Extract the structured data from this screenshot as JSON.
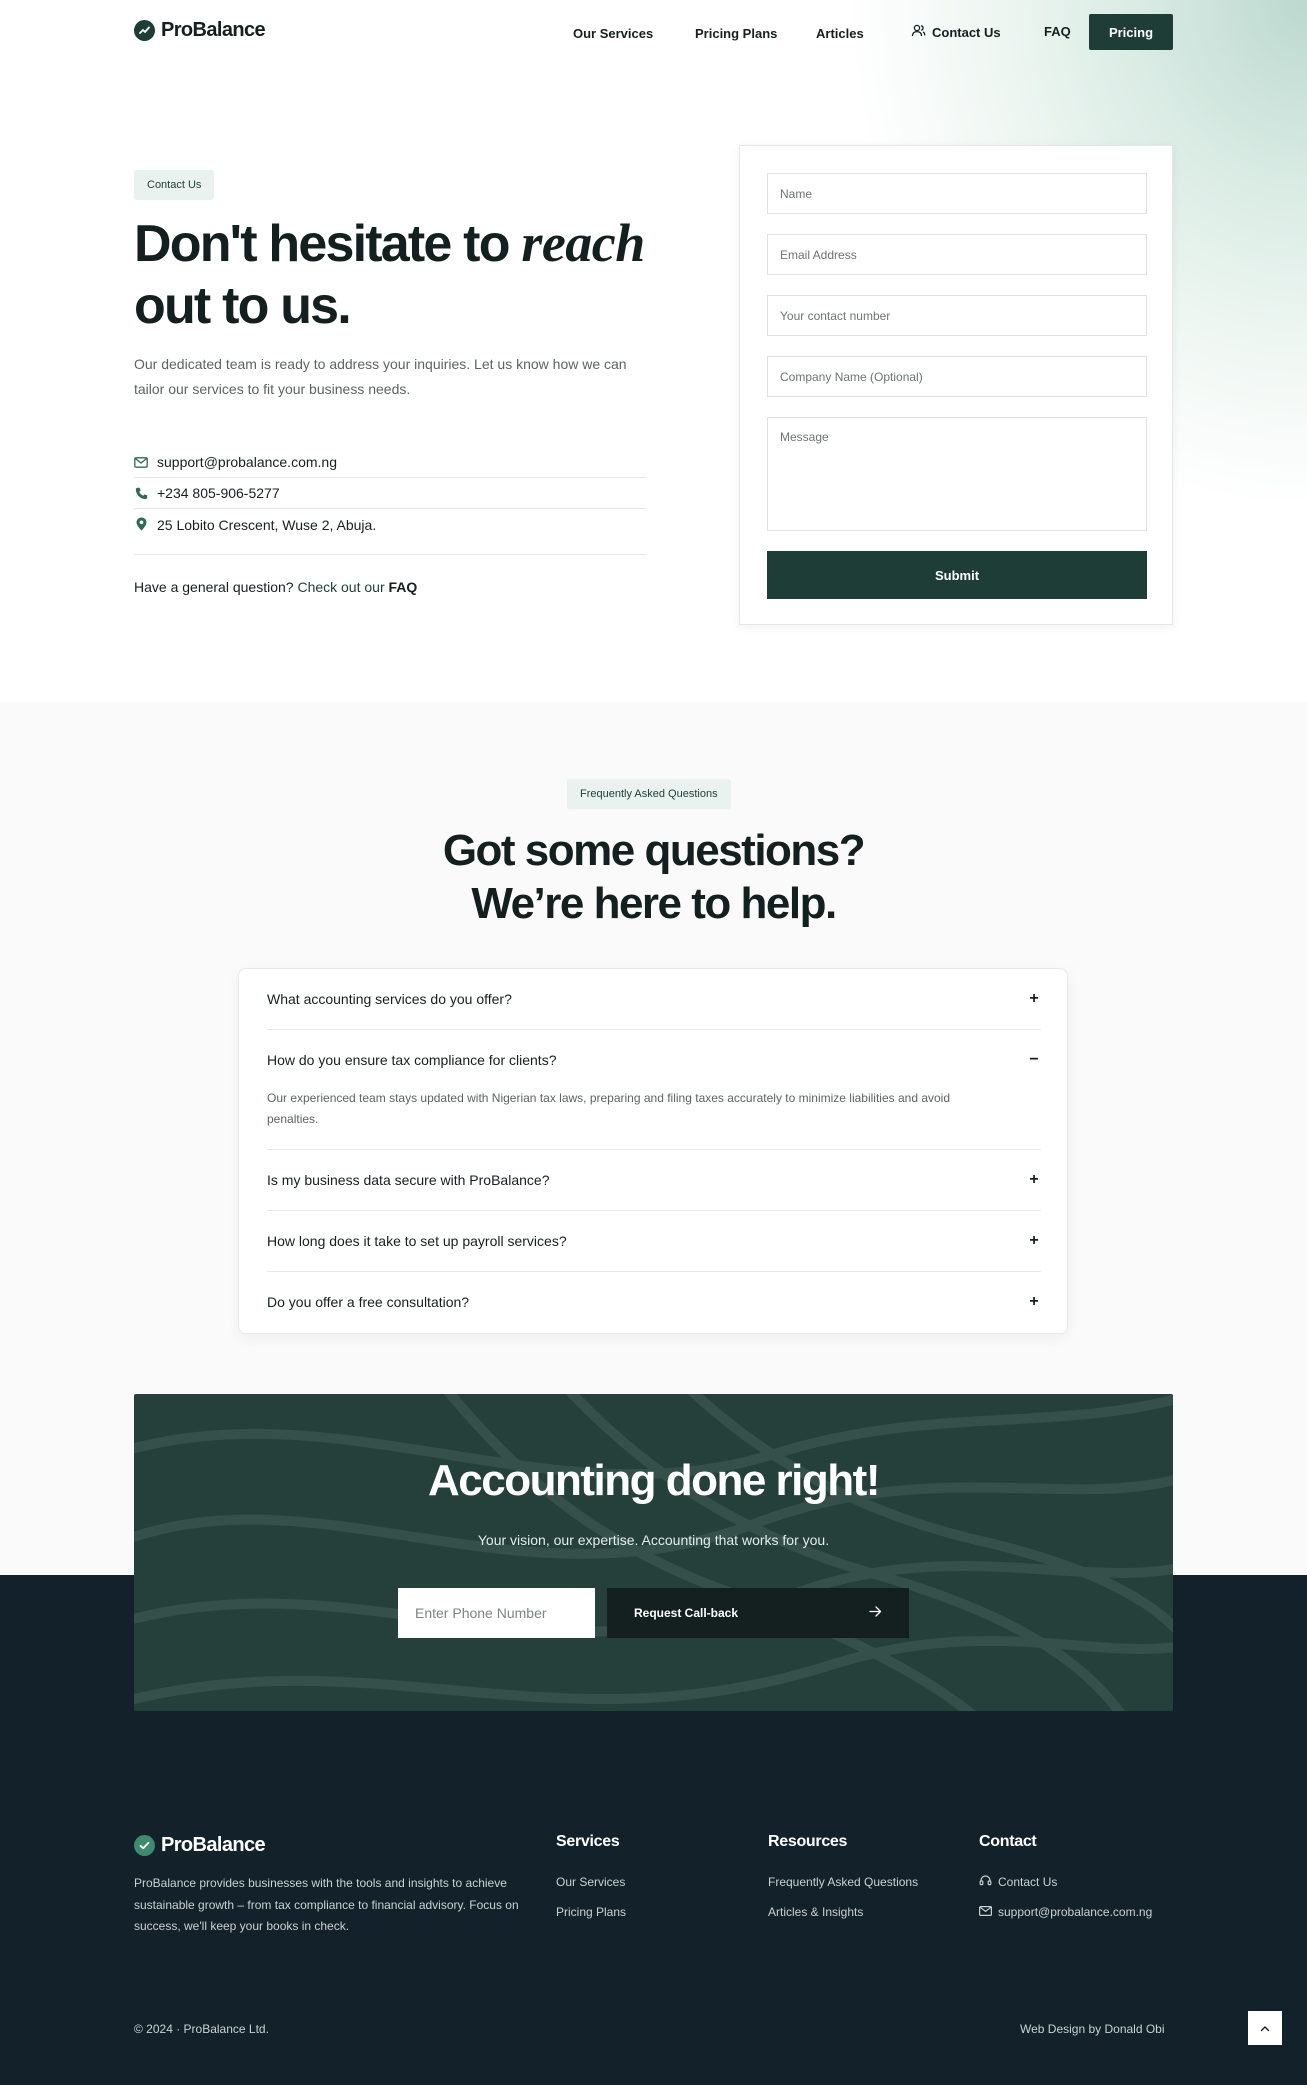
{
  "header": {
    "logo_text": "ProBalance",
    "nav": [
      {
        "label": "Our Services"
      },
      {
        "label": "Pricing Plans"
      },
      {
        "label": "Articles"
      },
      {
        "label": "Contact Us"
      }
    ],
    "faq_link": "FAQ",
    "pricing_button": "Pricing"
  },
  "contact": {
    "badge": "Contact Us",
    "title_part1": "Don't hesitate to ",
    "title_emphasis": "reach",
    "title_part2": "out to us.",
    "description": "Our dedicated team is ready to address your inquiries. Let us know  how we can tailor our services to fit your business needs.",
    "email": "support@probalance.com.ng",
    "phone": "+234 805-906-5277",
    "address": "25 Lobito Crescent, Wuse 2, Abuja.",
    "general_q_text": "Have a general question? ",
    "general_q_link": "Check out our ",
    "general_q_bold": "FAQ"
  },
  "form": {
    "name_placeholder": "Name",
    "email_placeholder": "Email Address",
    "phone_placeholder": "Your contact number",
    "company_placeholder": "Company Name (Optional)",
    "message_placeholder": "Message",
    "submit_label": "Submit"
  },
  "faq": {
    "badge": "Frequently Asked Questions",
    "title_line1": "Got some questions?",
    "title_line2": "We’re here to help.",
    "items": [
      {
        "question": "What accounting services do you offer?",
        "toggle": "+"
      },
      {
        "question": "How do you ensure tax compliance for clients?",
        "toggle": "−",
        "answer": "Our experienced team stays updated with Nigerian tax laws, preparing and filing taxes accurately to minimize liabilities and avoid penalties."
      },
      {
        "question": "Is my business data secure with ProBalance?",
        "toggle": "+"
      },
      {
        "question": "How long does it take to set up payroll services?",
        "toggle": "+"
      },
      {
        "question": "Do you offer a free consultation?",
        "toggle": "+"
      }
    ]
  },
  "cta": {
    "title": "Accounting done right!",
    "subtitle": "Your vision, our expertise. Accounting that works for you.",
    "phone_placeholder": "Enter Phone Number",
    "button_label": "Request Call-back"
  },
  "footer": {
    "logo_text": "ProBalance",
    "description": "ProBalance provides businesses with the tools and insights to achieve sustainable growth – from tax compliance to financial advisory. Focus on success, we'll keep your books in check.",
    "services": {
      "heading": "Services",
      "links": [
        "Our Services",
        "Pricing Plans"
      ]
    },
    "resources": {
      "heading": "Resources",
      "links": [
        "Frequently Asked Questions",
        "Articles & Insights"
      ]
    },
    "contact": {
      "heading": "Contact",
      "links": [
        "Contact Us",
        "support@probalance.com.ng"
      ]
    },
    "copyright": "© 2024 · ProBalance Ltd.",
    "credit": "Web Design by Donald Obi"
  },
  "colors": {
    "brand_dark": "#1f3d37",
    "footer_bg": "#13222a",
    "cta_bg": "#253f3a",
    "badge_bg": "#e9f2ee"
  },
  "icons": [
    "logo-check-icon",
    "user-group-icon",
    "mail-icon",
    "phone-icon",
    "location-pin-icon",
    "plus-icon",
    "minus-icon",
    "arrow-right-icon",
    "headset-icon",
    "chevron-up-icon"
  ]
}
